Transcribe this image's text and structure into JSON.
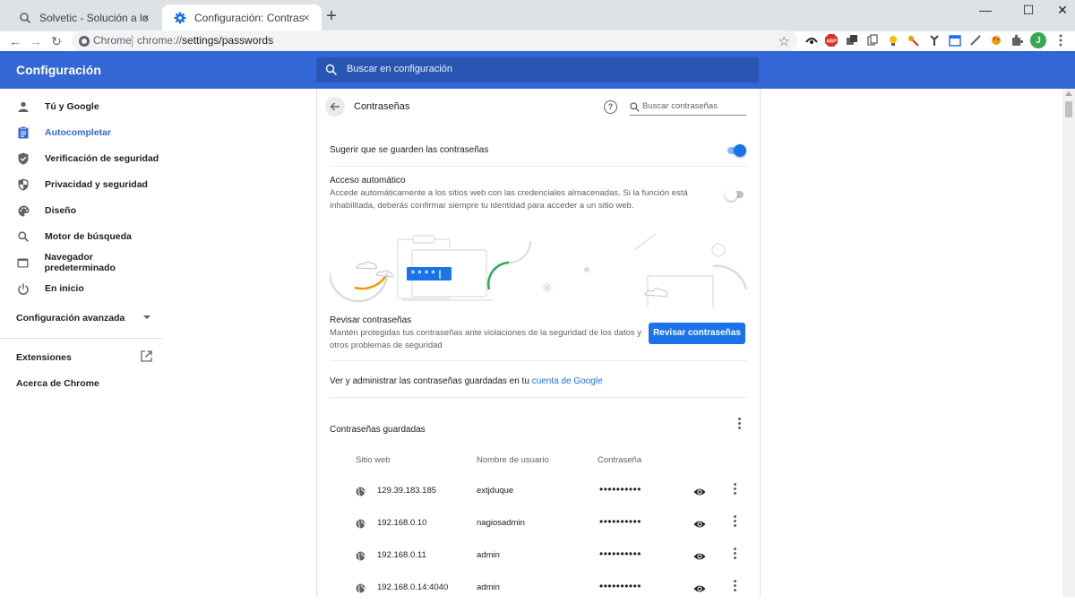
{
  "browser": {
    "tabs": [
      {
        "title": "Solvetic - Solución a los problem",
        "close": "×",
        "active": false
      },
      {
        "title": "Configuración: Contraseñas",
        "close": "×",
        "active": true
      }
    ],
    "new_tab": "+",
    "window_controls": {
      "minimize": "—",
      "maximize": "☐",
      "close": "✕"
    },
    "nav": {
      "back": "←",
      "forward": "→",
      "reload": "↻"
    },
    "omnibox": {
      "label": "Chrome",
      "url_scheme": "chrome://",
      "url_path": "settings/passwords",
      "bookmark_star": "☆"
    },
    "extensions": [
      "puzzle-icon"
    ],
    "profile_initial": "J"
  },
  "header": {
    "title": "Configuración",
    "search_placeholder": "Buscar en configuración"
  },
  "sidebar": {
    "items": [
      {
        "label": "Tú y Google",
        "icon": "person-icon",
        "active": false
      },
      {
        "label": "Autocompletar",
        "icon": "clipboard-icon",
        "active": true
      },
      {
        "label": "Verificación de seguridad",
        "icon": "shield-check-icon",
        "active": false
      },
      {
        "label": "Privacidad y seguridad",
        "icon": "shield-icon",
        "active": false
      },
      {
        "label": "Diseño",
        "icon": "palette-icon",
        "active": false
      },
      {
        "label": "Motor de búsqueda",
        "icon": "search-icon",
        "active": false
      },
      {
        "label": "Navegador predeterminado",
        "icon": "browser-icon",
        "active": false
      },
      {
        "label": "En inicio",
        "icon": "power-icon",
        "active": false
      }
    ],
    "advanced": "Configuración avanzada",
    "extensions": "Extensiones",
    "about": "Acerca de Chrome"
  },
  "passwords": {
    "title": "Contraseñas",
    "search_placeholder": "Buscar contraseñas",
    "offer_save": "Sugerir que se guarden las contraseñas",
    "offer_save_on": true,
    "auto_signin_title": "Acceso automático",
    "auto_signin_desc": "Accede automáticamente a los sitios web con las credenciales almacenadas. Si la función está inhabilitada, deberás confirmar siempre tu identidad para acceder a un sitio web.",
    "auto_signin_on": false,
    "illustration_password": "****|",
    "check_title": "Revisar contraseñas",
    "check_desc": "Mantén protegidas tus contraseñas ante violaciones de la seguridad de los datos y otros problemas de seguridad",
    "check_button": "Revisar contraseñas",
    "manage_text": "Ver y administrar las contraseñas guardadas en tu",
    "manage_link": "cuenta de Google",
    "saved_title": "Contraseñas guardadas",
    "columns": {
      "site": "Sitio web",
      "user": "Nombre de usuario",
      "password": "Contraseña"
    },
    "rows": [
      {
        "site": "129.39.183.185",
        "user": "extjduque",
        "password": "••••••••••"
      },
      {
        "site": "192.168.0.10",
        "user": "nagiosadmin",
        "password": "••••••••••"
      },
      {
        "site": "192.168.0.11",
        "user": "admin",
        "password": "••••••••••"
      },
      {
        "site": "192.168.0.14:4040",
        "user": "admin",
        "password": "••••••••••"
      }
    ]
  },
  "colors": {
    "header_blue": "#3367d6",
    "accent_blue": "#1a73e8",
    "toggle_on": "#1a73e8",
    "illustration_orange": "#f29900",
    "illustration_green": "#34a853"
  }
}
